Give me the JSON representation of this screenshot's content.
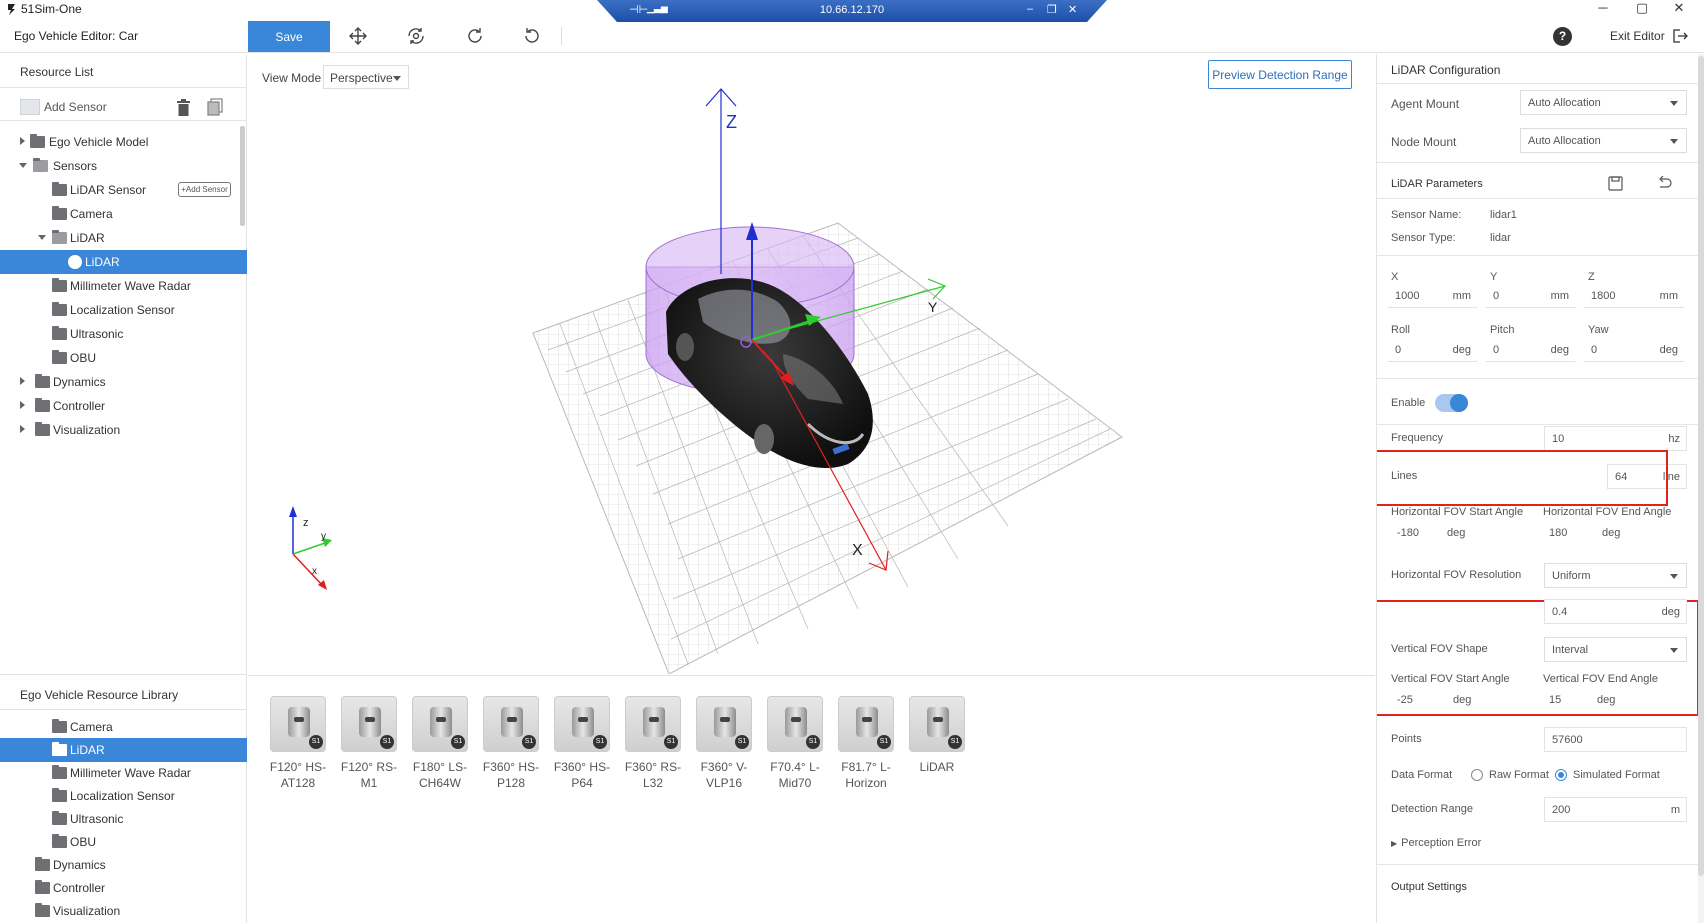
{
  "window": {
    "app_title": "51Sim-One",
    "remote_ip": "10.66.12.170",
    "controls": {
      "minimize": "─",
      "maximize": "▢",
      "close": "✕"
    },
    "remote_controls": {
      "pin": "⊣⊢",
      "minimize": "–",
      "restore": "❐",
      "close": "✕"
    }
  },
  "toolbar": {
    "editor_title": "Ego Vehicle Editor: Car",
    "save_label": "Save",
    "help_label": "?",
    "exit_label": "Exit Editor"
  },
  "resource_list": {
    "title": "Resource List",
    "add_sensor": "Add Sensor",
    "tree": [
      {
        "label": "Ego Vehicle Model",
        "type": "folder",
        "caret": "right"
      },
      {
        "label": "Sensors",
        "type": "folder-open",
        "caret": "down"
      },
      {
        "label": "LiDAR Sensor",
        "type": "folder",
        "tag": "+Add Sensor"
      },
      {
        "label": "Camera",
        "type": "folder"
      },
      {
        "label": "LiDAR",
        "type": "folder-open",
        "caret": "down"
      },
      {
        "label": "LiDAR",
        "type": "item",
        "selected": true
      },
      {
        "label": "Millimeter Wave Radar",
        "type": "folder"
      },
      {
        "label": "Localization Sensor",
        "type": "folder"
      },
      {
        "label": "Ultrasonic",
        "type": "folder"
      },
      {
        "label": "OBU",
        "type": "folder"
      },
      {
        "label": "Dynamics",
        "type": "folder",
        "caret": "right"
      },
      {
        "label": "Controller",
        "type": "folder",
        "caret": "right"
      },
      {
        "label": "Visualization",
        "type": "folder",
        "caret": "right"
      }
    ]
  },
  "library": {
    "title": "Ego Vehicle Resource Library",
    "items": [
      {
        "label": "Camera"
      },
      {
        "label": "LiDAR",
        "selected": true
      },
      {
        "label": "Millimeter Wave Radar"
      },
      {
        "label": "Localization Sensor"
      },
      {
        "label": "Ultrasonic"
      },
      {
        "label": "OBU"
      },
      {
        "label": "Dynamics"
      },
      {
        "label": "Controller"
      },
      {
        "label": "Visualization"
      }
    ]
  },
  "viewport": {
    "view_mode_label": "View Mode",
    "view_mode_value": "Perspective",
    "preview_button": "Preview Detection Range",
    "axis_labels": {
      "z": "Z",
      "y": "Y",
      "x": "X"
    },
    "gizmo_labels": {
      "z": "z",
      "y": "y",
      "x": "x"
    }
  },
  "sensor_tiles": [
    {
      "line1": "F120° HS-",
      "line2": "AT128",
      "badge": "S1"
    },
    {
      "line1": "F120° RS-",
      "line2": "M1",
      "badge": "S1"
    },
    {
      "line1": "F180° LS-",
      "line2": "CH64W",
      "badge": "S1"
    },
    {
      "line1": "F360° HS-",
      "line2": "P128",
      "badge": "S1"
    },
    {
      "line1": "F360° HS-",
      "line2": "P64",
      "badge": "S1"
    },
    {
      "line1": "F360° RS-",
      "line2": "L32",
      "badge": "S1"
    },
    {
      "line1": "F360° V-",
      "line2": "VLP16",
      "badge": "S1"
    },
    {
      "line1": "F70.4° L-",
      "line2": "Mid70",
      "badge": "S1"
    },
    {
      "line1": "F81.7° L-",
      "line2": "Horizon",
      "badge": "S1"
    },
    {
      "line1": "LiDAR",
      "line2": "",
      "badge": "S1"
    }
  ],
  "config": {
    "title": "LiDAR Configuration",
    "agent_mount_label": "Agent Mount",
    "agent_mount_value": "Auto Allocation",
    "node_mount_label": "Node Mount",
    "node_mount_value": "Auto Allocation",
    "params_title": "LiDAR Parameters",
    "sensor_name_label": "Sensor Name:",
    "sensor_name_value": "lidar1",
    "sensor_type_label": "Sensor Type:",
    "sensor_type_value": "lidar",
    "x_label": "X",
    "x_value": "1000",
    "x_unit": "mm",
    "y_label": "Y",
    "y_value": "0",
    "y_unit": "mm",
    "z_label": "Z",
    "z_value": "1800",
    "z_unit": "mm",
    "roll_label": "Roll",
    "roll_value": "0",
    "roll_unit": "deg",
    "pitch_label": "Pitch",
    "pitch_value": "0",
    "pitch_unit": "deg",
    "yaw_label": "Yaw",
    "yaw_value": "0",
    "yaw_unit": "deg",
    "enable_label": "Enable",
    "enable_on": true,
    "frequency_label": "Frequency",
    "frequency_value": "10",
    "frequency_unit": "hz",
    "lines_label": "Lines",
    "lines_value": "64",
    "lines_unit": "line",
    "hfov_start_label": "Horizontal FOV Start Angle",
    "hfov_start_value": "-180",
    "hfov_start_unit": "deg",
    "hfov_end_label": "Horizontal FOV End Angle",
    "hfov_end_value": "180",
    "hfov_end_unit": "deg",
    "hfov_res_label": "Horizontal FOV Resolution",
    "hfov_res_value": "Uniform",
    "res_value": "0.4",
    "res_unit": "deg",
    "vfov_shape_label": "Vertical FOV Shape",
    "vfov_shape_value": "Interval",
    "vfov_start_label": "Vertical FOV Start Angle",
    "vfov_start_value": "-25",
    "vfov_start_unit": "deg",
    "vfov_end_label": "Vertical FOV End Angle",
    "vfov_end_value": "15",
    "vfov_end_unit": "deg",
    "points_label": "Points",
    "points_value": "57600",
    "data_format_label": "Data Format",
    "raw_format_label": "Raw Format",
    "sim_format_label": "Simulated Format",
    "data_format_selected": "Simulated Format",
    "detection_range_label": "Detection Range",
    "detection_range_value": "200",
    "detection_range_unit": "m",
    "perception_error_label": "Perception Error",
    "output_settings_label": "Output Settings"
  },
  "colors": {
    "accent": "#3a86d8",
    "highlight_box": "#e2231a",
    "fov_volume": "#b07ee0",
    "axis_z": "#1f2fd1",
    "axis_y": "#2ecc2e",
    "axis_x": "#e02020"
  }
}
